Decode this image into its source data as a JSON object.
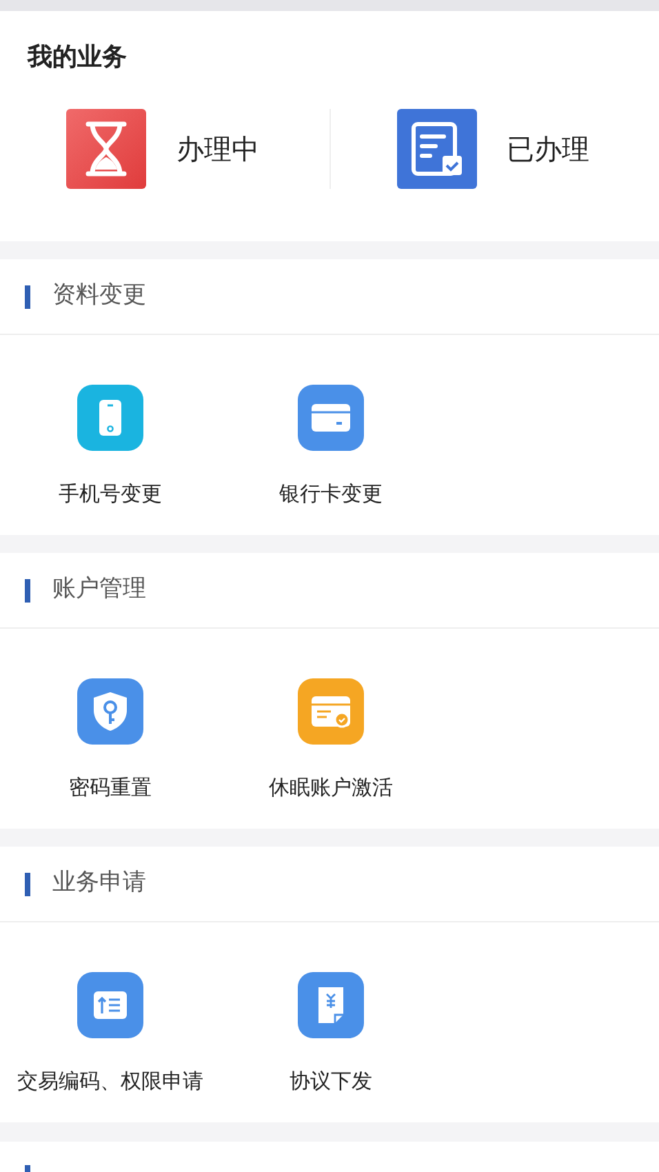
{
  "my_business": {
    "title": "我的业务",
    "items": [
      {
        "label": "办理中",
        "kind": "pending"
      },
      {
        "label": "已办理",
        "kind": "done"
      }
    ]
  },
  "sections": [
    {
      "title": "资料变更",
      "items": [
        {
          "label": "手机号变更",
          "kind": "phone",
          "color": "#1ab4e0"
        },
        {
          "label": "银行卡变更",
          "kind": "card",
          "color": "#4a90e8"
        }
      ]
    },
    {
      "title": "账户管理",
      "items": [
        {
          "label": "密码重置",
          "kind": "shield",
          "color": "#4a90e8"
        },
        {
          "label": "休眠账户激活",
          "kind": "activate",
          "color": "#f5a623"
        }
      ]
    },
    {
      "title": "业务申请",
      "items": [
        {
          "label": "交易编码、权限申请",
          "kind": "list",
          "color": "#4a90e8"
        },
        {
          "label": "协议下发",
          "kind": "doc",
          "color": "#4a90e8"
        }
      ]
    }
  ]
}
